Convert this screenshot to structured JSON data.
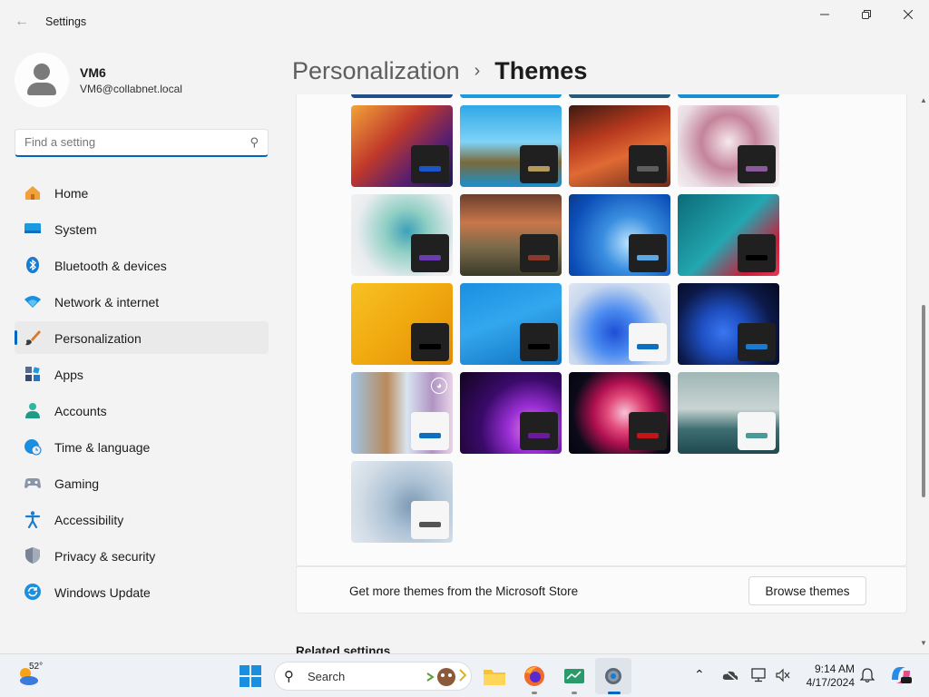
{
  "window": {
    "title": "Settings",
    "back_icon": "arrow-left-icon",
    "minimize_icon": "minimize-icon",
    "maximize_icon": "restore-icon",
    "close_icon": "close-icon"
  },
  "profile": {
    "name": "VM6",
    "email": "VM6@collabnet.local"
  },
  "search": {
    "placeholder": "Find a setting",
    "value": ""
  },
  "nav": {
    "items": [
      {
        "label": "Home",
        "icon": "home-icon",
        "active": false
      },
      {
        "label": "System",
        "icon": "monitor-icon",
        "active": false
      },
      {
        "label": "Bluetooth & devices",
        "icon": "bluetooth-icon",
        "active": false
      },
      {
        "label": "Network & internet",
        "icon": "wifi-icon",
        "active": false
      },
      {
        "label": "Personalization",
        "icon": "paintbrush-icon",
        "active": true
      },
      {
        "label": "Apps",
        "icon": "apps-icon",
        "active": false
      },
      {
        "label": "Accounts",
        "icon": "person-icon",
        "active": false
      },
      {
        "label": "Time & language",
        "icon": "clock-globe-icon",
        "active": false
      },
      {
        "label": "Gaming",
        "icon": "gamepad-icon",
        "active": false
      },
      {
        "label": "Accessibility",
        "icon": "accessibility-icon",
        "active": false
      },
      {
        "label": "Privacy & security",
        "icon": "shield-icon",
        "active": false
      },
      {
        "label": "Windows Update",
        "icon": "update-icon",
        "active": false
      }
    ]
  },
  "header": {
    "parent": "Personalization",
    "current": "Themes",
    "separator_icon": "chevron-right-icon"
  },
  "themes": [
    {
      "bg": "linear-gradient(135deg,#f2a33a 0%,#c0392b 40%,#5a1f6e 70%,#1d1b4a 100%)",
      "chip": "dark",
      "accent": "#1a55c9",
      "badge": false
    },
    {
      "bg": "linear-gradient(180deg,#2fa8e6 0%,#7fd3f7 45%,#7a6a3a 70%,#1a8fd0 100%)",
      "chip": "dark",
      "accent": "#b39a5b",
      "badge": false
    },
    {
      "bg": "linear-gradient(160deg,#3b1b12 0%,#b5381d 35%,#e06a34 60%,#6b2a1a 100%)",
      "chip": "dark",
      "accent": "#5d5d5d",
      "badge": false
    },
    {
      "bg": "radial-gradient(circle at 50% 45%,#f6e9ee 0%,#c4839a 40%,#e9dbe2 75%,#f4f0f2 100%)",
      "chip": "dark",
      "accent": "#8a5a9a",
      "badge": false
    },
    {
      "bg": "radial-gradient(circle at 55% 45%,#3ea0b8 0%,#8fcfc4 30%,#e9ecef 70%,#f3f3f3 100%)",
      "chip": "dark",
      "accent": "#6b3bb1",
      "badge": false
    },
    {
      "bg": "linear-gradient(180deg,#6a3f2e 0%,#c9764a 35%,#7a6a4a 65%,#3a3a2a 100%)",
      "chip": "dark",
      "accent": "#8a3a2a",
      "badge": false
    },
    {
      "bg": "radial-gradient(circle at 60% 60%,#bfe6ff 0%,#3a8fe0 35%,#0c4fb8 75%,#083a8a 100%)",
      "chip": "dark",
      "accent": "#5aa9e6",
      "badge": false
    },
    {
      "bg": "linear-gradient(135deg,#0b6b78 0%,#23a6b0 50%,#c81d3a 80%,#e23a54 100%)",
      "chip": "dark",
      "accent": "#000000",
      "badge": false
    },
    {
      "bg": "linear-gradient(135deg,#f7c223 0%,#f0a90f 50%,#e38a06 100%)",
      "chip": "dark",
      "accent": "#000000",
      "badge": false
    },
    {
      "bg": "linear-gradient(160deg,#1a8fe0 0%,#33a7ee 45%,#0f6fbf 100%)",
      "chip": "dark",
      "accent": "#000000",
      "badge": false
    },
    {
      "bg": "radial-gradient(circle at 45% 60%,#1d4fd6 0%,#4b8bf0 30%,#c9d8ee 65%,#e6ecf4 100%)",
      "chip": "light",
      "accent": "#0f6fbf",
      "badge": false
    },
    {
      "bg": "radial-gradient(circle at 45% 60%,#3a76f0 0%,#1e4fc2 30%,#0c1a4a 65%,#05081e 100%)",
      "chip": "dark",
      "accent": "#1a7ad0",
      "badge": false
    },
    {
      "bg": "linear-gradient(90deg,#9fc4e6 0%,#b98a5a 35%,#d8e4f0 55%,#b094c4 80%,#e8d4e8 100%)",
      "chip": "light",
      "accent": "#0f6fbf",
      "badge": true
    },
    {
      "bg": "radial-gradient(circle at 70% 70%,#e08ad8 0%,#9b2fd6 25%,#3a0a6a 55%,#12041e 100%)",
      "chip": "dark",
      "accent": "#6a1a9a",
      "badge": false
    },
    {
      "bg": "radial-gradient(circle at 55% 50%,#f6c4d8 0%,#e24a7a 25%,#b01050 45%,#0a0a1a 75%,#050510 100%)",
      "chip": "dark",
      "accent": "#c4141a",
      "badge": false
    },
    {
      "bg": "linear-gradient(180deg,#9fb7b6 0%,#c8d4d2 45%,#3e6e72 70%,#1f4a4e 100%)",
      "chip": "light",
      "accent": "#4a9a9a",
      "badge": false
    },
    {
      "bg": "radial-gradient(circle at 60% 55%,#7d99b3 0%,#aec3d6 35%,#d3dde6 70%,#e4eaf0 100%)",
      "chip": "light",
      "accent": "#555555",
      "badge": false
    }
  ],
  "store": {
    "text": "Get more themes from the Microsoft Store",
    "button": "Browse themes"
  },
  "related": {
    "heading": "Related settings"
  },
  "taskbar": {
    "temperature": "52°",
    "search_label": "Search",
    "time": "9:14 AM",
    "date": "4/17/2024"
  },
  "colors": {
    "accent": "#0067c0",
    "window_bg": "#f3f3f3",
    "card_bg": "#fbfbfb"
  }
}
